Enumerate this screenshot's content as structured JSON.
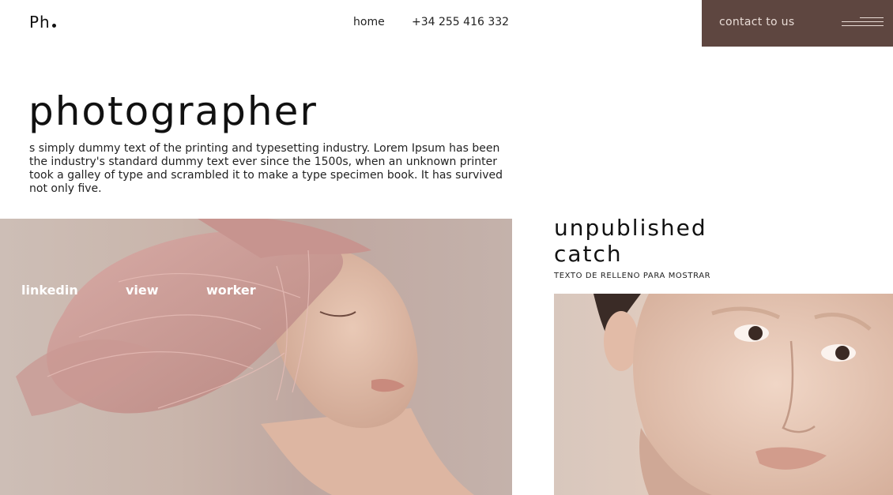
{
  "header": {
    "logo": "Ph",
    "nav": {
      "home": "home",
      "phone": "+34 255 416 332"
    },
    "contact_label": "contact to us",
    "menu_icon": "hamburger-menu-icon",
    "accent_color": "#5e4640"
  },
  "hero": {
    "title": "photographer",
    "description": "s simply dummy text of the printing and typesetting industry. Lorem Ipsum has been the industry's standard dummy text ever since the 1500s, when an unknown printer took a galley of type and scrambled it to make a type specimen book. It has survived not only five."
  },
  "gallery": {
    "social_links": [
      "linkedin",
      "view",
      "worker"
    ]
  },
  "feature": {
    "title": "unpublished catch",
    "subtitle": "TEXTO DE RELLENO PARA MOSTRAR"
  }
}
